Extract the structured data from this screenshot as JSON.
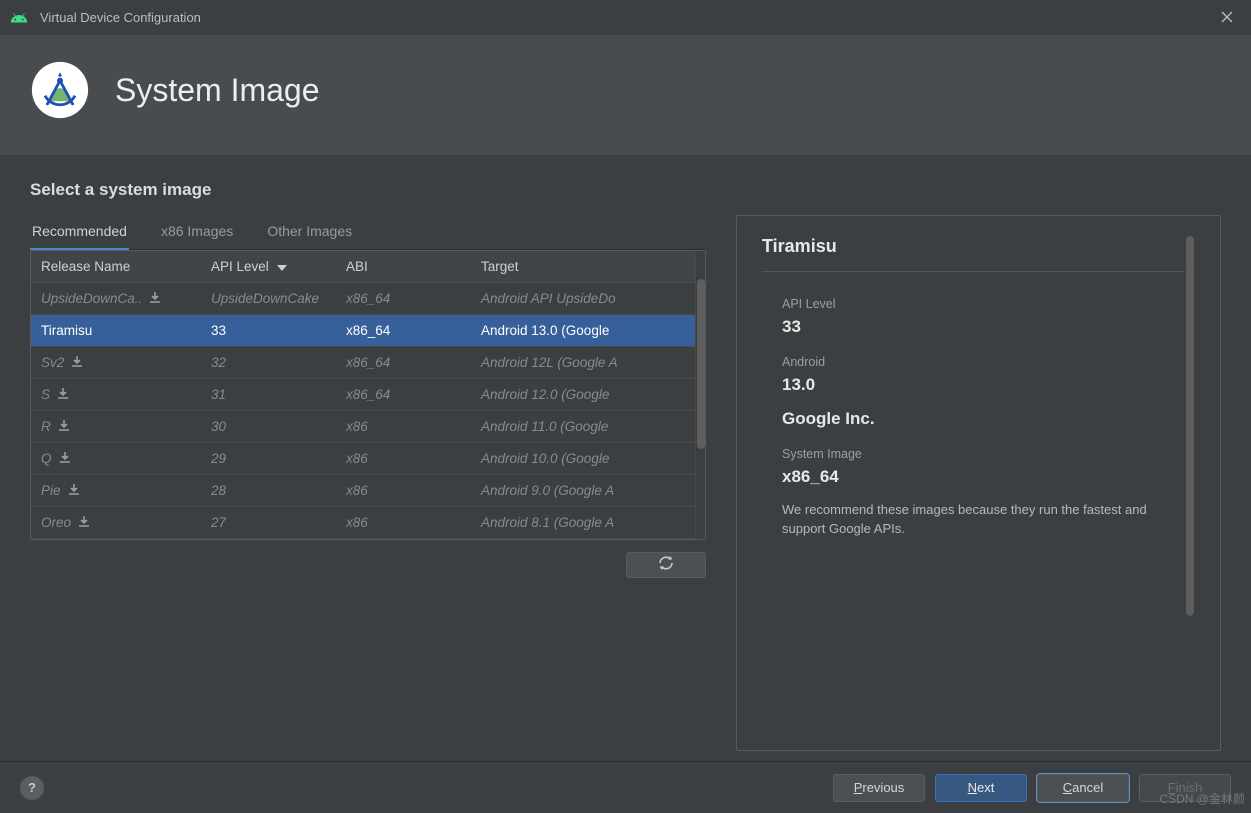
{
  "window": {
    "title": "Virtual Device Configuration"
  },
  "header": {
    "title": "System Image"
  },
  "subtitle": "Select a system image",
  "tabs": [
    {
      "label": "Recommended",
      "active": true
    },
    {
      "label": "x86 Images",
      "active": false
    },
    {
      "label": "Other Images",
      "active": false
    }
  ],
  "columns": {
    "c0": "Release Name",
    "c1": "API Level",
    "c2": "ABI",
    "c3": "Target",
    "sort_col": "API Level",
    "sort_dir": "desc"
  },
  "rows": [
    {
      "release": "UpsideDownCa..",
      "api": "UpsideDownCake",
      "abi": "x86_64",
      "target": "Android API UpsideDo",
      "download": true,
      "selected": false
    },
    {
      "release": "Tiramisu",
      "api": "33",
      "abi": "x86_64",
      "target": "Android 13.0 (Google",
      "download": false,
      "selected": true
    },
    {
      "release": "Sv2",
      "api": "32",
      "abi": "x86_64",
      "target": "Android 12L (Google A",
      "download": true,
      "selected": false
    },
    {
      "release": "S",
      "api": "31",
      "abi": "x86_64",
      "target": "Android 12.0 (Google",
      "download": true,
      "selected": false
    },
    {
      "release": "R",
      "api": "30",
      "abi": "x86",
      "target": "Android 11.0 (Google",
      "download": true,
      "selected": false
    },
    {
      "release": "Q",
      "api": "29",
      "abi": "x86",
      "target": "Android 10.0 (Google",
      "download": true,
      "selected": false
    },
    {
      "release": "Pie",
      "api": "28",
      "abi": "x86",
      "target": "Android 9.0 (Google A",
      "download": true,
      "selected": false
    },
    {
      "release": "Oreo",
      "api": "27",
      "abi": "x86",
      "target": "Android 8.1 (Google A",
      "download": true,
      "selected": false
    }
  ],
  "detail": {
    "title": "Tiramisu",
    "api_label": "API Level",
    "api_value": "33",
    "android_label": "Android",
    "android_value": "13.0",
    "company": "Google Inc.",
    "sysimage_label": "System Image",
    "sysimage_value": "x86_64",
    "description": "We recommend these images because they run the fastest and support Google APIs."
  },
  "footer": {
    "previous": "Previous",
    "next": "Next",
    "cancel": "Cancel",
    "finish": "Finish"
  },
  "watermark": "CSDN @金林颜"
}
